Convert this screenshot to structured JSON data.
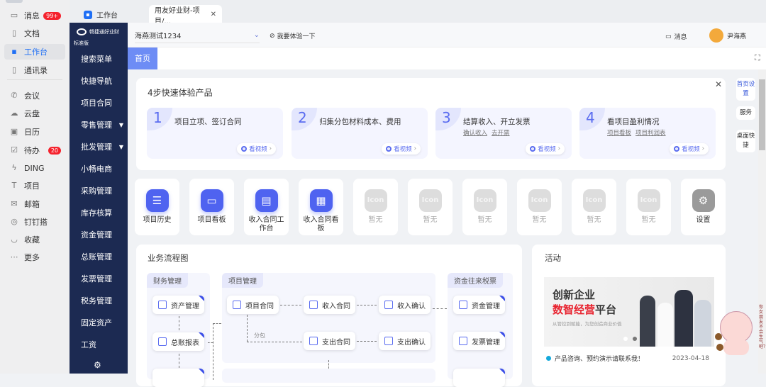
{
  "ding_sidebar": {
    "items": [
      {
        "label": "消息",
        "icon": "chat-icon",
        "badge": "99+"
      },
      {
        "label": "文档",
        "icon": "document-icon"
      },
      {
        "label": "工作台",
        "icon": "grid-icon",
        "active": true
      },
      {
        "label": "通讯录",
        "icon": "contacts-icon"
      },
      {
        "label": "会议",
        "icon": "phone-icon"
      },
      {
        "label": "云盘",
        "icon": "cloud-icon"
      },
      {
        "label": "日历",
        "icon": "calendar-icon"
      },
      {
        "label": "待办",
        "icon": "todo-icon",
        "badge": "20"
      },
      {
        "label": "DING",
        "icon": "lightning-icon"
      },
      {
        "label": "项目",
        "icon": "project-icon"
      },
      {
        "label": "邮箱",
        "icon": "mail-icon"
      },
      {
        "label": "钉钉搭",
        "icon": "builder-icon"
      },
      {
        "label": "收藏",
        "icon": "favorite-icon"
      },
      {
        "label": "更多",
        "icon": "more-icon"
      }
    ]
  },
  "tabs": [
    {
      "label": "工作台"
    },
    {
      "label": "用友好业财-项目/..."
    }
  ],
  "nav": {
    "brand": "畅捷通好业财",
    "edition": "标准版",
    "items": [
      {
        "label": "搜索菜单"
      },
      {
        "label": "快捷导航"
      },
      {
        "label": "项目合同"
      },
      {
        "label": "零售管理",
        "arrow": true
      },
      {
        "label": "批发管理",
        "arrow": true
      },
      {
        "label": "小畅电商"
      },
      {
        "label": "采购管理"
      },
      {
        "label": "库存核算"
      },
      {
        "label": "资金管理"
      },
      {
        "label": "总账管理"
      },
      {
        "label": "发票管理"
      },
      {
        "label": "税务管理"
      },
      {
        "label": "固定资产"
      },
      {
        "label": "工资"
      }
    ]
  },
  "header": {
    "account": "海燕测试1234",
    "try_label": "我要体验一下",
    "message_label": "消息",
    "user_name": "尹海燕"
  },
  "page_tabs": [
    {
      "label": "首页"
    }
  ],
  "quick_start": {
    "title": "4步快速体验产品",
    "video_label": "看视频",
    "steps": [
      {
        "num": "1",
        "title": "项目立项、签订合同",
        "links": []
      },
      {
        "num": "2",
        "title": "归集分包材料成本、费用",
        "links": []
      },
      {
        "num": "3",
        "title": "结算收入、开立发票",
        "links": [
          "确认收入",
          "去开票"
        ]
      },
      {
        "num": "4",
        "title": "看项目盈利情况",
        "links": [
          "项目看板",
          "项目利润表"
        ]
      }
    ]
  },
  "side_buttons": [
    "首页设置",
    "服务",
    "桌面快捷"
  ],
  "shortcuts": [
    {
      "label": "项目历史",
      "icon": "list-icon"
    },
    {
      "label": "项目看板",
      "icon": "monitor-icon"
    },
    {
      "label": "收入合同工作台",
      "icon": "workbench-icon"
    },
    {
      "label": "收入合同看板",
      "icon": "board-icon"
    },
    {
      "label": "暂无",
      "placeholder": "Icon"
    },
    {
      "label": "暂无",
      "placeholder": "Icon"
    },
    {
      "label": "暂无",
      "placeholder": "Icon"
    },
    {
      "label": "暂无",
      "placeholder": "Icon"
    },
    {
      "label": "暂无",
      "placeholder": "Icon"
    },
    {
      "label": "暂无",
      "placeholder": "Icon"
    },
    {
      "label": "设置",
      "icon": "gear-icon"
    }
  ],
  "flow": {
    "title": "业务流程图",
    "groups": [
      "财务管理",
      "项目管理",
      "资金往来税票"
    ],
    "branch_label": "分包",
    "nodes": {
      "asset": "资产管理",
      "ledger": "总账报表",
      "project_contract": "项目合同",
      "income_contract": "收入合同",
      "income_confirm": "收入确认",
      "expense_contract": "支出合同",
      "expense_confirm": "支出确认",
      "fund": "资金管理",
      "invoice": "发票管理"
    }
  },
  "activity": {
    "title": "活动",
    "banner": {
      "line1": "创新企业",
      "line2_red": "数智经营",
      "line2_rest": "平台",
      "subtitle": "从管控到赋能，为您创造商业价值"
    },
    "items": [
      {
        "text": "产品咨询、预约演示请联系我！",
        "date": "2023-04-18"
      }
    ]
  },
  "mascot_caption": "你女朋友不会生气吧？",
  "colors": {
    "accent": "#4f63f0",
    "nav_bg": "#1c2a52",
    "badge": "#f5222d"
  }
}
